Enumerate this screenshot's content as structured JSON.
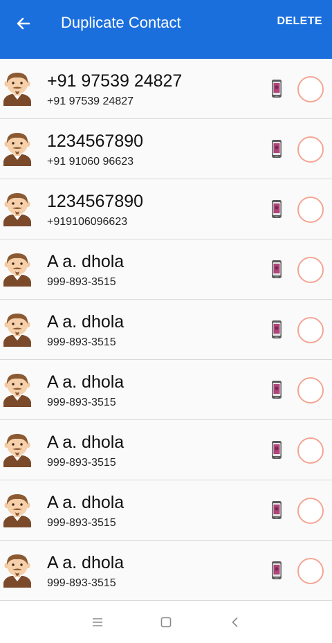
{
  "header": {
    "title": "Duplicate Contact",
    "delete_label": "DELETE",
    "back_icon": "arrow-left-icon",
    "background_color": "#1b6fdd"
  },
  "contacts": [
    {
      "name": "+91 97539 24827",
      "number": "+91 97539 24827"
    },
    {
      "name": "1234567890",
      "number": "+91 91060 96623"
    },
    {
      "name": "1234567890",
      "number": "+919106096623"
    },
    {
      "name": "A a. dhola",
      "number": "999-893-3515"
    },
    {
      "name": "A a. dhola",
      "number": "999-893-3515"
    },
    {
      "name": "A a. dhola",
      "number": "999-893-3515"
    },
    {
      "name": "A a. dhola",
      "number": "999-893-3515"
    },
    {
      "name": "A a. dhola",
      "number": "999-893-3515"
    },
    {
      "name": "A a. dhola",
      "number": "999-893-3515"
    }
  ],
  "row_icons": {
    "avatar": "man-avatar-icon",
    "source": "phone-icon",
    "select": "radio-unchecked"
  },
  "colors": {
    "radio_border": "#f4a593",
    "divider": "#d9d9d9"
  },
  "nav": {
    "icons": [
      "menu-icon",
      "home-square-icon",
      "back-chevron-icon"
    ]
  }
}
